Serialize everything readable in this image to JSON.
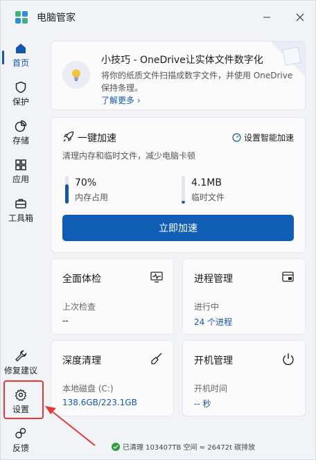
{
  "app": {
    "title": "电脑管家"
  },
  "sidebar": {
    "items": [
      {
        "label": "首页"
      },
      {
        "label": "保护"
      },
      {
        "label": "存储"
      },
      {
        "label": "应用"
      },
      {
        "label": "工具箱"
      }
    ],
    "bottom_items": [
      {
        "label": "修复建议"
      },
      {
        "label": "设置"
      },
      {
        "label": "反馈"
      }
    ]
  },
  "tip": {
    "title": "小技巧 - OneDrive让实体文件数字化",
    "description": "将你的纸质文件扫描成数字文件，并使用 OneDrive 保持条理。",
    "link": "了解更多 ›"
  },
  "speed": {
    "title": "一键加速",
    "smart_link": "设置智能加速",
    "description": "清理内存和临时文件，减少电脑卡顿",
    "memory": {
      "value": "70%",
      "label": "内存占用",
      "fill": 0.7
    },
    "temp": {
      "value": "4.1MB",
      "label": "临时文件",
      "fill": 0.1
    },
    "button": "立即加速"
  },
  "tiles": {
    "checkup": {
      "title": "全面体检",
      "label": "上次检查",
      "value": "--"
    },
    "process": {
      "title": "进程管理",
      "label": "进行中",
      "value": "24 个进程"
    },
    "cleanup": {
      "title": "深度清理",
      "label": "本地磁盘 (C:)",
      "value": "138.6GB/223.1GB"
    },
    "startup": {
      "title": "开机管理",
      "label": "开机时间",
      "value": "-- 秒"
    }
  },
  "status": {
    "text": "已清理 103407TB 空间 ≈ 26472t 碳排放"
  },
  "colors": {
    "accent": "#1557b0",
    "button": "#0f5db5",
    "annotation": "#e53935"
  }
}
